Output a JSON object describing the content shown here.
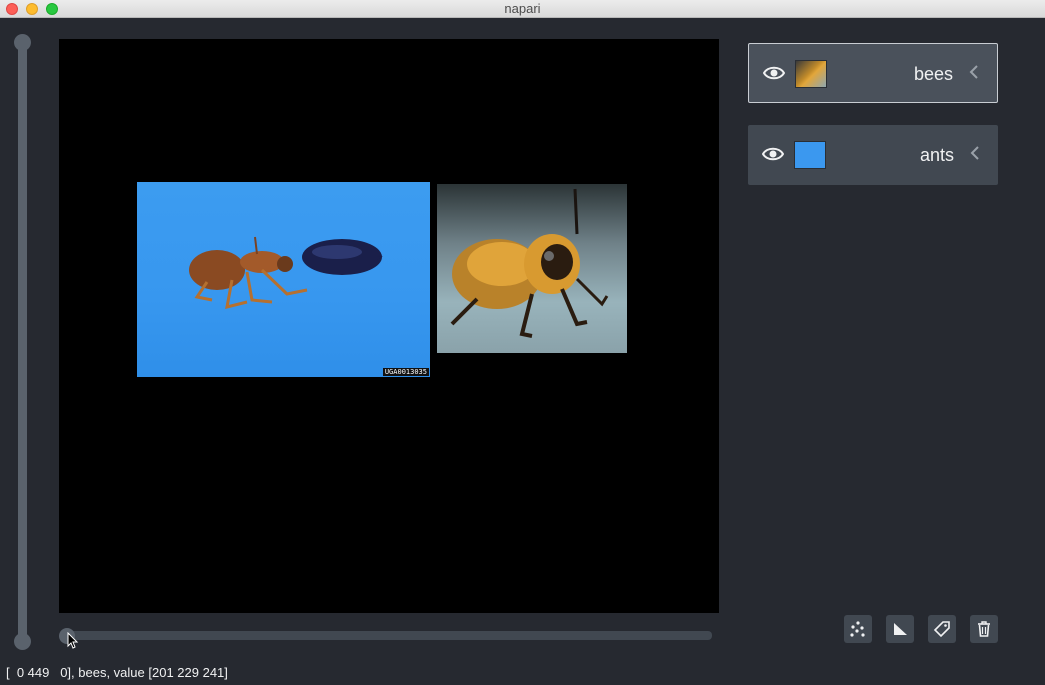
{
  "window": {
    "title": "napari"
  },
  "canvas": {
    "ants_image_label": "UGA0013035"
  },
  "layers": [
    {
      "name": "bees",
      "visible": true,
      "selected": true,
      "thumbnail_icon": "bees-thumbnail"
    },
    {
      "name": "ants",
      "visible": true,
      "selected": false,
      "thumbnail_icon": "ants-thumbnail"
    }
  ],
  "layer_buttons": [
    {
      "name": "new-points-layer",
      "icon": "points-icon"
    },
    {
      "name": "new-shapes-layer",
      "icon": "shapes-icon"
    },
    {
      "name": "new-labels-layer",
      "icon": "label-tag-icon"
    },
    {
      "name": "delete-layer",
      "icon": "trash-icon"
    }
  ],
  "status_bar": {
    "text": "[  0 449   0], bees, value [201 229 241]"
  },
  "colors": {
    "background": "#262930",
    "panel": "#414851",
    "foreground": "#f0f1f2",
    "slider": "#5a626c"
  }
}
